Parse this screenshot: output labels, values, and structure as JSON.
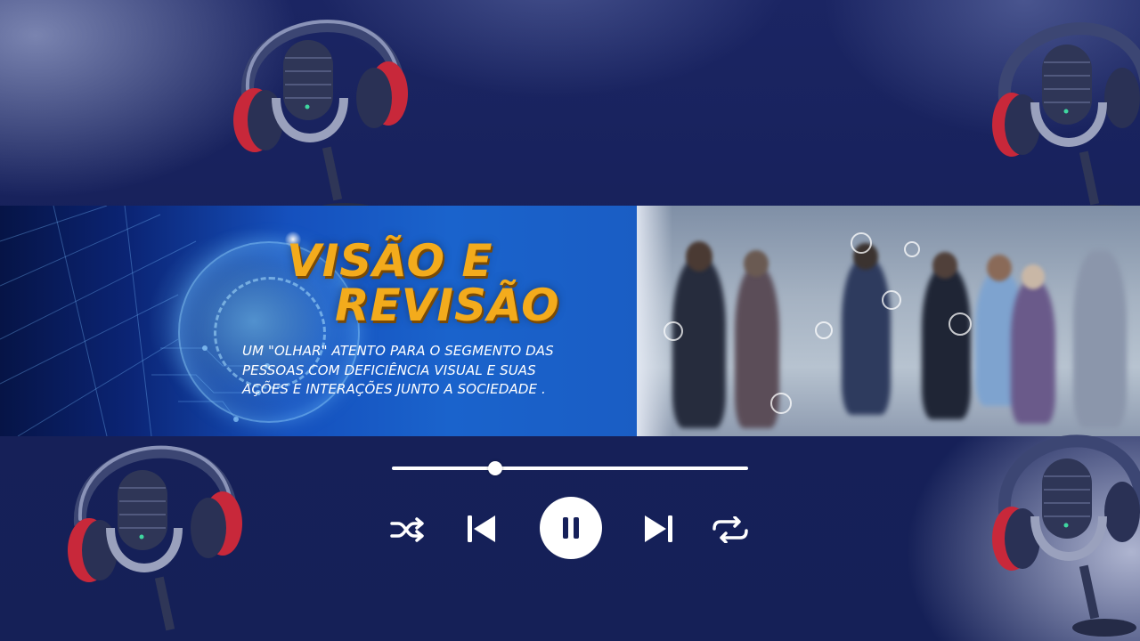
{
  "banner": {
    "title_line1": "VISÃO E",
    "title_line2": "REVISÃO",
    "subtitle_lines": [
      "UM \"OLHAR\" ATENTO PARA O SEGMENTO DAS",
      "PESSOAS COM DEFICIÊNCIA VISUAL E SUAS",
      "AÇÕES E INTERAÇÕES JUNTO A SOCIEDADE ."
    ]
  },
  "player": {
    "progress": 0.29,
    "state": "playing",
    "controls": [
      "shuffle-icon",
      "skip-previous-icon",
      "pause-icon",
      "skip-next-icon",
      "repeat-icon"
    ]
  },
  "decor": {
    "icons": [
      "podcast-microphone-headphones-icon"
    ],
    "colors": {
      "background": "#16205a",
      "title": "#f3ab1c",
      "controls": "#ffffff",
      "headphone_cushion": "#c8283a"
    }
  }
}
